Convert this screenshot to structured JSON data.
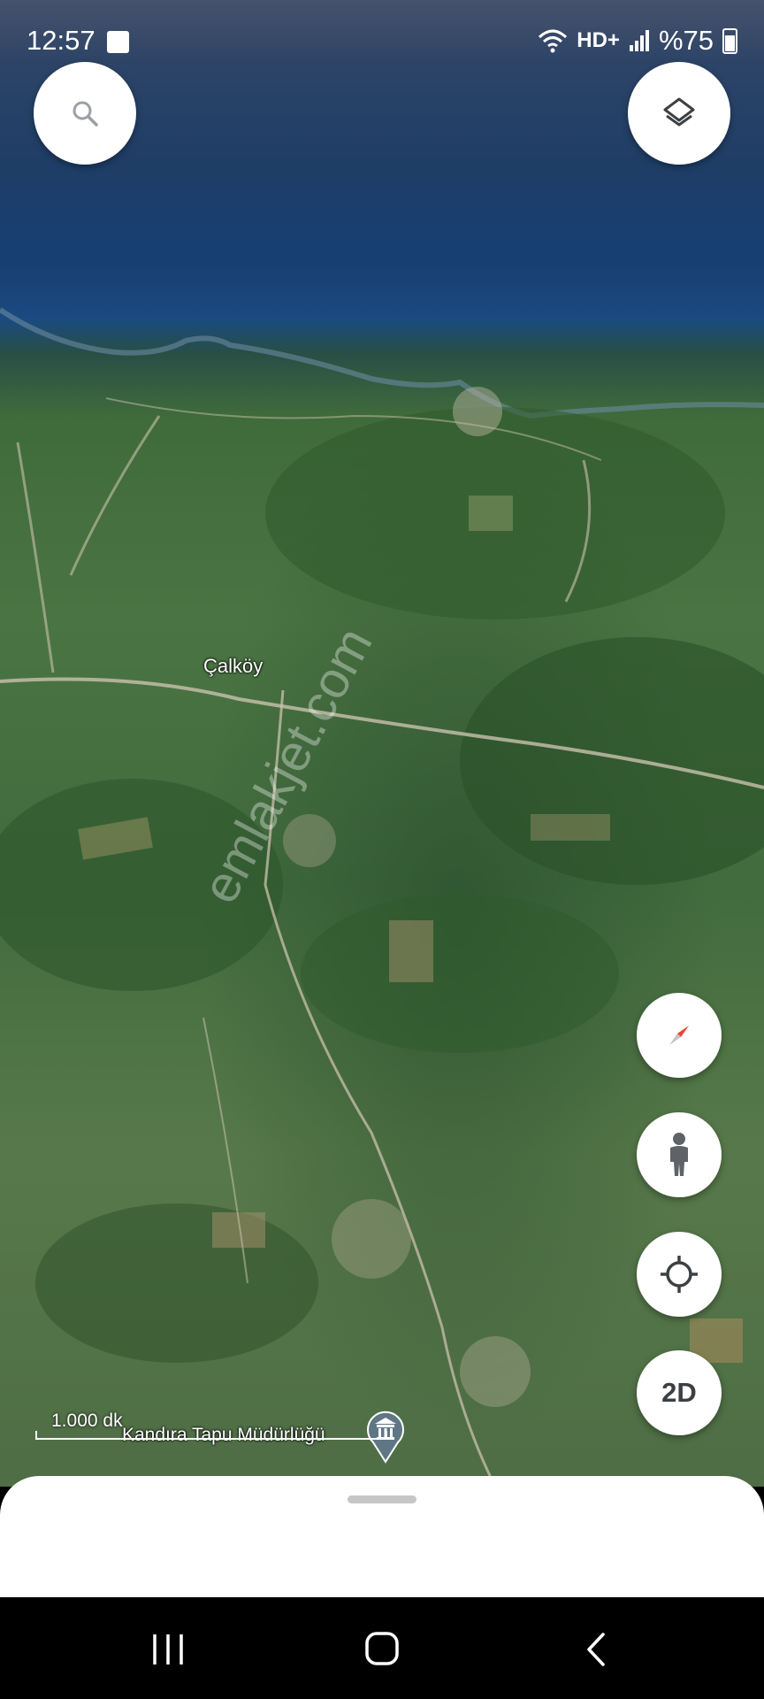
{
  "status_bar": {
    "time": "12:57",
    "network": "HD+",
    "battery": "%75",
    "icons": [
      "gallery-icon",
      "wifi-icon",
      "signal-icon",
      "battery-icon"
    ]
  },
  "map": {
    "type": "satellite-3d",
    "place_label": "Çalköy",
    "poi_label": "Kandıra Tapu Müdürlüğü",
    "poi_icon": "government-building-icon",
    "scale_text": "1.000 dk",
    "watermark": "emlakjet.com"
  },
  "controls": {
    "search_icon": "search-icon",
    "layers_icon": "layers-icon",
    "compass_icon": "compass-icon",
    "street_view_icon": "pegman-icon",
    "my_location_icon": "my-location-icon",
    "view_mode_label": "2D"
  },
  "colors": {
    "sea": "#1a4a80",
    "land": "#4b7443",
    "compass_red": "#ea4335",
    "button_bg": "#ffffff",
    "icon_gray": "#5f6368"
  },
  "nav_bar": {
    "icons": [
      "recents-icon",
      "home-icon",
      "back-icon"
    ]
  }
}
